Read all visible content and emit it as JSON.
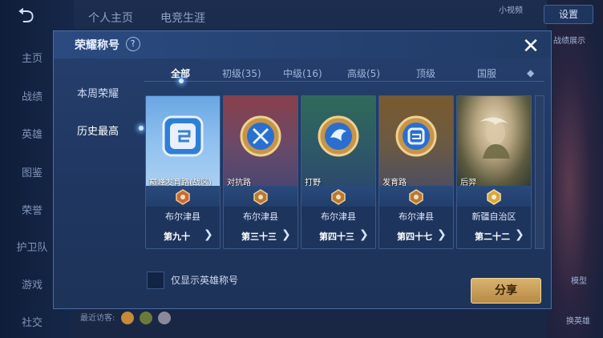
{
  "background": {
    "top_tabs": [
      "个人主页",
      "电竞生涯"
    ],
    "left_nav": [
      "主页",
      "战绩",
      "英雄",
      "图鉴",
      "荣誉",
      "护卫队",
      "游戏",
      "社交"
    ],
    "settings_label": "设置",
    "right_small_1": "小视频",
    "right_small_2": "战绩展示",
    "right_hint_1": "模型",
    "right_hint_2": "换英雄",
    "recent_visitors": "最近访客:"
  },
  "modal": {
    "title": "荣耀称号",
    "side_items": [
      "本周荣耀",
      "历史最高"
    ],
    "tabs": [
      "全部",
      "初级(35)",
      "中级(16)",
      "高级(5)",
      "顶级",
      "国服"
    ],
    "cards": [
      {
        "name": "巅峰发育路(战区)",
        "region": "布尔津县",
        "rank": "第九十"
      },
      {
        "name": "对抗路",
        "region": "布尔津县",
        "rank": "第三十三"
      },
      {
        "name": "打野",
        "region": "布尔津县",
        "rank": "第四十三"
      },
      {
        "name": "发育路",
        "region": "布尔津县",
        "rank": "第四十七"
      },
      {
        "name": "后羿",
        "region": "新疆自治区",
        "rank": "第二十二"
      }
    ],
    "checkbox_label": "仅显示英雄称号",
    "share_label": "分享"
  },
  "colors": {
    "modal_bg": "#253f6d",
    "share_button": "#c99c57",
    "accent_blue": "#66aaff"
  }
}
